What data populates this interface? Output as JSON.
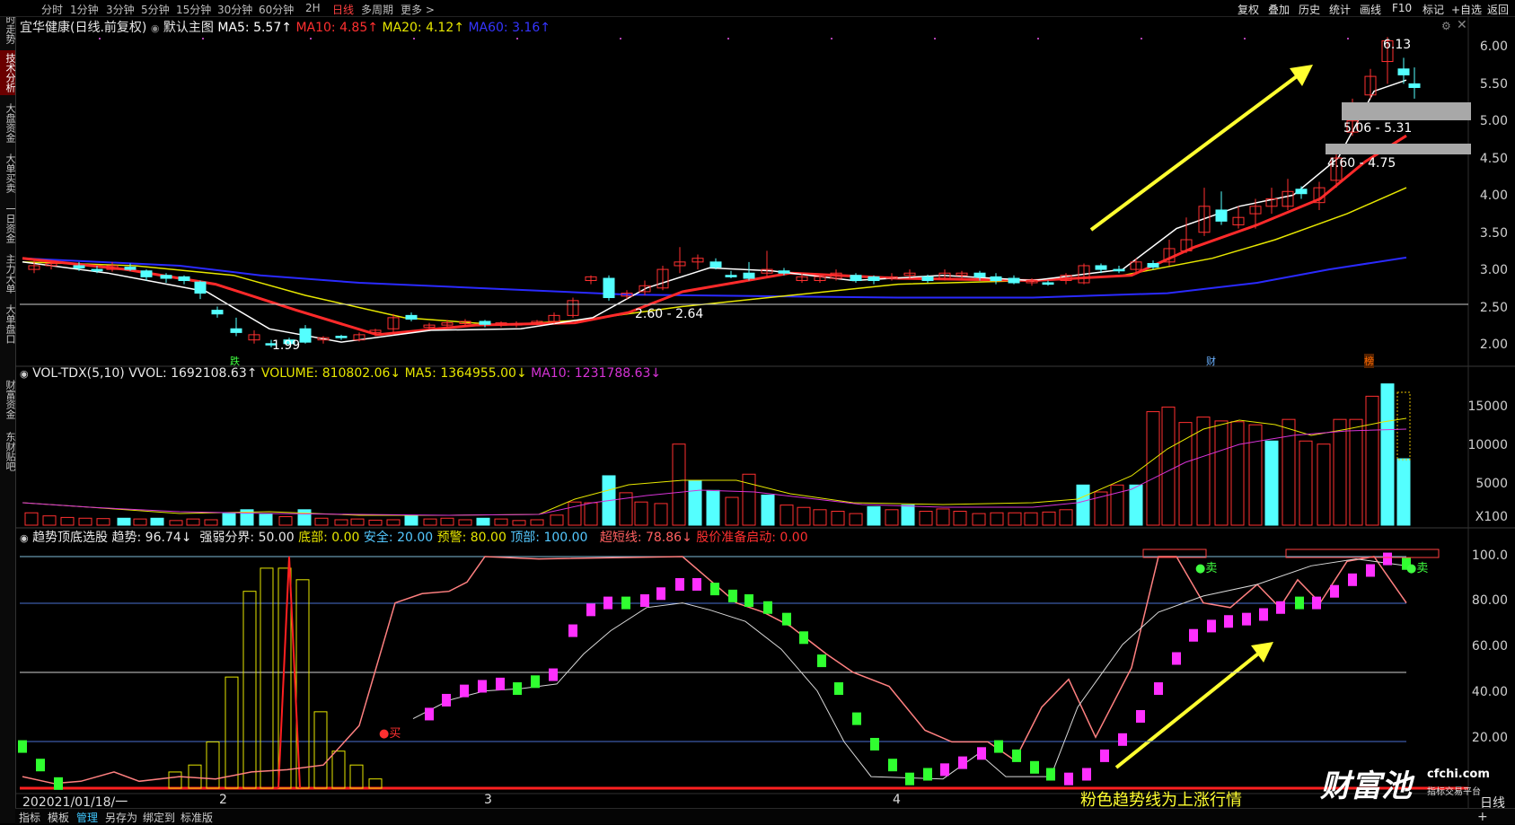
{
  "topbar": {
    "tabs": [
      "分时",
      "1分钟",
      "3分钟",
      "5分钟",
      "15分钟",
      "30分钟",
      "60分钟",
      "2H",
      "日线",
      "多周期",
      "更多 >"
    ],
    "active_tab": "日线",
    "right_buttons": [
      "复权",
      "叠加",
      "历史",
      "统计",
      "画线",
      "F10",
      "标记",
      "+自选",
      "返回"
    ]
  },
  "sidebar": {
    "items": [
      "分时走势",
      "技术分析",
      "大盘资金",
      "大单买卖",
      "一日资金",
      "主力大单",
      "大单盘口",
      "财富资金",
      "东财贴吧"
    ],
    "active": "技术分析"
  },
  "main_panel": {
    "title": "宜华健康(日线.前复权)",
    "template": "默认主图",
    "ma5": "MA5: 5.57↑",
    "ma10": "MA10: 4.85↑",
    "ma20": "MA20: 4.12↑",
    "ma60": "MA60: 3.16↑",
    "y_ticks": [
      "6.00",
      "5.50",
      "5.00",
      "4.50",
      "4.00",
      "3.50",
      "3.00",
      "2.50",
      "2.00"
    ],
    "annotations": {
      "high": "6.13",
      "low": "1.99",
      "mid_band": "2.60 - 2.64",
      "gap1": "5.06 - 5.31",
      "gap2": "4.60 - 4.75",
      "mark_die": "跌",
      "mark_cai": "财",
      "mark_bang": "榜"
    },
    "colors": {
      "ma5": "#ffffff",
      "ma10": "#ff2a2a",
      "ma20": "#e6e600",
      "ma60": "#2a2aff",
      "up": "#ff3030",
      "down": "#54ffff"
    }
  },
  "volume_panel": {
    "name": "VOL-TDX(5,10)",
    "vvol": "VVOL: 1692108.63↑",
    "volume": "VOLUME: 810802.06↓",
    "ma5": "MA5: 1364955.00↓",
    "ma10": "MA10: 1231788.63↓",
    "y_ticks": [
      "15000",
      "10000",
      "5000",
      "X100"
    ]
  },
  "indicator_panel": {
    "name": "趋势顶底选股",
    "trend": "趋势: 96.74↓",
    "strength": "强弱分界: 50.00",
    "bottom": "底部: 0.00",
    "safe": "安全: 20.00",
    "warn": "预警: 80.00",
    "top": "顶部: 100.00",
    "super_short": "超短线: 78.86↓",
    "ready": "股价准备启动: 0.00",
    "y_ticks": [
      "100.0",
      "80.00",
      "60.00",
      "40.00",
      "20.00"
    ],
    "buy_label": "买",
    "sell_label_1": "卖",
    "sell_label_2": "卖",
    "caption": "粉色趋势线为上涨行情"
  },
  "time_axis": {
    "labels": [
      "202021/01/18/一",
      "2",
      "3",
      "4"
    ],
    "period": "日线"
  },
  "bottombar": {
    "buttons": [
      "指标",
      "模板",
      "管理",
      "另存为",
      "绑定到",
      "标准版"
    ],
    "active": "管理"
  },
  "watermark": {
    "brand": "财富池",
    "site": "cfchi.com",
    "tagline": "指标交易平台"
  }
}
